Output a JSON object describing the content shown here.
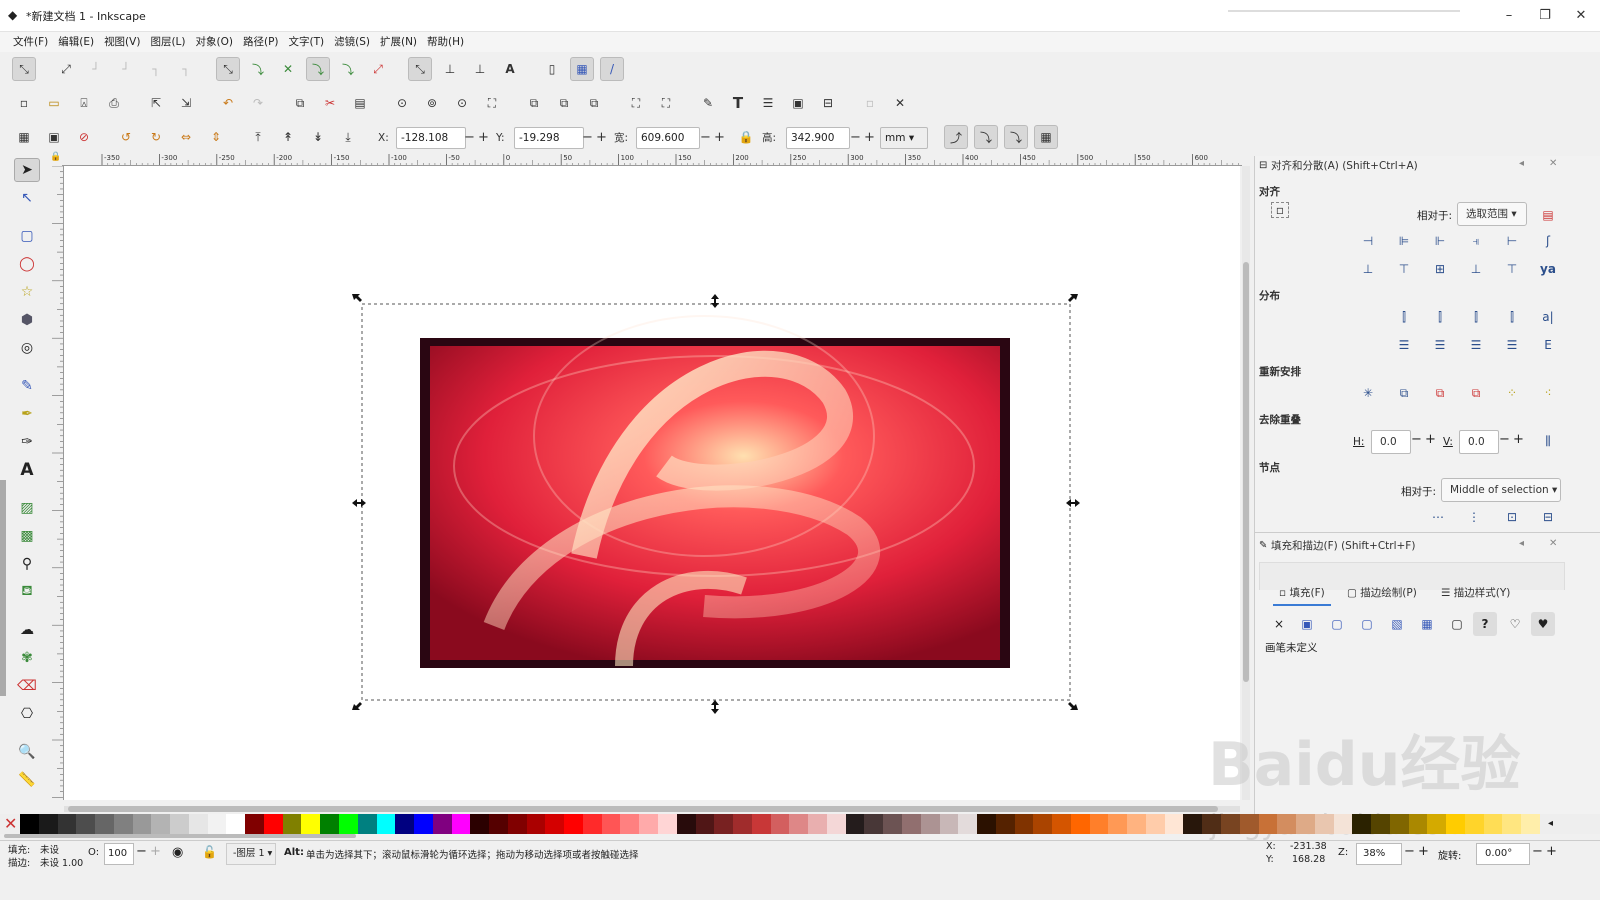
{
  "window": {
    "title": "*新建文档 1 - Inkscape",
    "minimize": "–",
    "restore": "❐",
    "close": "✕"
  },
  "menu": [
    "文件(F)",
    "编辑(E)",
    "视图(V)",
    "图层(L)",
    "对象(O)",
    "路径(P)",
    "文字(T)",
    "滤镜(S)",
    "扩展(N)",
    "帮助(H)"
  ],
  "select_toolbar": {
    "x_label": "X:",
    "x_value": "-128.108",
    "y_label": "Y:",
    "y_value": "-19.298",
    "w_label": "宽:",
    "w_value": "609.600",
    "h_label": "高:",
    "h_value": "342.900",
    "unit": "mm",
    "minus": "−",
    "plus": "+"
  },
  "ruler": {
    "ticks": [
      "-350",
      "-300",
      "-250",
      "-200",
      "-150",
      "-100",
      "-50",
      "0",
      "50",
      "100",
      "150",
      "200",
      "250",
      "300",
      "350",
      "400",
      "450",
      "500",
      "550",
      "600"
    ]
  },
  "align_dialog": {
    "title": "对齐和分散(A) (Shift+Ctrl+A)",
    "align_section": "对齐",
    "relative_label": "相对于:",
    "relative_value": "选取范围",
    "distribute_section": "分布",
    "rearrange_section": "重新安排",
    "remove_overlap_section": "去除重叠",
    "h_label": "H:",
    "h_value": "0.0",
    "v_label": "V:",
    "v_value": "0.0",
    "nodes_section": "节点",
    "nodes_relative_label": "相对于:",
    "nodes_relative_value": "Middle of selection"
  },
  "fill_stroke_dialog": {
    "title": "填充和描边(F) (Shift+Ctrl+F)",
    "tabs": [
      "填充(F)",
      "描边绘制(P)",
      "描边样式(Y)"
    ],
    "no_paint": "×",
    "unknown": "?",
    "status": "画笔未定义"
  },
  "statusbar": {
    "fill_label": "填充:",
    "fill_value": "未设",
    "stroke_label": "描边:",
    "stroke_value": "未设 1.00",
    "opacity_label": "O:",
    "opacity_value": "100",
    "layer": "-图层 1",
    "message_key": "Alt:",
    "message": "单击为选择其下；滚动鼠标滑轮为循环选择；拖动为移动选择项或者按触碰选择",
    "x_label": "X:",
    "x_value": "-231.38",
    "y_label": "Y:",
    "y_value": "168.28",
    "z_label": "Z:",
    "zoom": "38%",
    "rotate_label": "旋转:",
    "rotate_value": "0.00°"
  },
  "watermark": {
    "text": "Baidu经验",
    "url": "jingyan.baidu.com"
  },
  "colors": {
    "selection_dash": "#555555",
    "image_red": "#e0203a",
    "accent": "#2c4f8c"
  },
  "palette": [
    "#000000",
    "#1a1a1a",
    "#333333",
    "#4d4d4d",
    "#666666",
    "#808080",
    "#999999",
    "#b3b3b3",
    "#cccccc",
    "#e6e6e6",
    "#f2f2f2",
    "#ffffff",
    "#800000",
    "#ff0000",
    "#808000",
    "#ffff00",
    "#008000",
    "#00ff00",
    "#008080",
    "#00ffff",
    "#000080",
    "#0000ff",
    "#800080",
    "#ff00ff",
    "#2b0000",
    "#550000",
    "#800000",
    "#aa0000",
    "#d40000",
    "#ff0000",
    "#ff2a2a",
    "#ff5555",
    "#ff8080",
    "#ffaaaa",
    "#ffd5d5",
    "#280b0b",
    "#501616",
    "#782121",
    "#a02c2c",
    "#c83737",
    "#d35f5f",
    "#de8787",
    "#e9afaf",
    "#f4d7d7",
    "#241c1c",
    "#483737",
    "#6c5353",
    "#916f6f",
    "#ac9393",
    "#c8b7b7",
    "#e3dbdb",
    "#2b1100",
    "#552200",
    "#803300",
    "#aa4400",
    "#d45500",
    "#ff6600",
    "#ff7f2a",
    "#ff9955",
    "#ffb380",
    "#ffccaa",
    "#ffe6d5",
    "#28170b",
    "#502d16",
    "#784421",
    "#a05a2c",
    "#c87137",
    "#d38d5f",
    "#deaa87",
    "#e9c6af",
    "#f4e3d7",
    "#2b2200",
    "#554400",
    "#806600",
    "#aa8800",
    "#d4aa00",
    "#ffcc00",
    "#ffd42a",
    "#ffdd55",
    "#ffe680",
    "#ffeeaa"
  ]
}
